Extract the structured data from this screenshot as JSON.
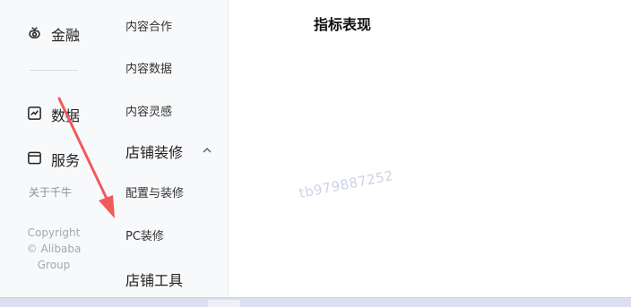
{
  "left_rail": {
    "items": [
      {
        "label": "金融",
        "icon": "money-bag-icon"
      },
      {
        "label": "数据",
        "icon": "chart-icon"
      },
      {
        "label": "服务",
        "icon": "window-icon"
      }
    ],
    "about": "关于千牛",
    "copyright": [
      "Copyright",
      "© Alibaba",
      "Group"
    ]
  },
  "sub_nav": {
    "items_top": [
      "内容合作",
      "内容数据",
      "内容灵感"
    ],
    "section": {
      "label": "店铺装修",
      "expanded": true
    },
    "section_items": [
      "配置与装修",
      "PC装修"
    ],
    "next_section": "店铺工具"
  },
  "main": {
    "title": "指标表现",
    "watermark": "tb979887252"
  },
  "colors": {
    "annotation_arrow": "#f05a5a",
    "sidebar_bg": "#f8f9fb"
  }
}
